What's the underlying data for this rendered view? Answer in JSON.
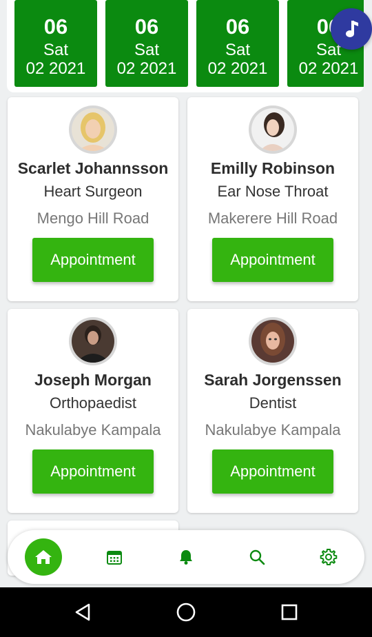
{
  "dates": [
    {
      "day": "06",
      "weekday": "Sat",
      "month_year": "02 2021"
    },
    {
      "day": "06",
      "weekday": "Sat",
      "month_year": "02 2021"
    },
    {
      "day": "06",
      "weekday": "Sat",
      "month_year": "02 2021"
    },
    {
      "day": "06",
      "weekday": "Sat",
      "month_year": "02 2021"
    }
  ],
  "doctors": [
    {
      "name": "Scarlet Johannsson",
      "specialty": "Heart Surgeon",
      "address": "Mengo Hill Road",
      "button": "Appointment"
    },
    {
      "name": "Emilly Robinson",
      "specialty": "Ear Nose Throat",
      "address": "Makerere Hill Road",
      "button": "Appointment"
    },
    {
      "name": "Joseph Morgan",
      "specialty": "Orthopaedist",
      "address": "Nakulabye Kampala",
      "button": "Appointment"
    },
    {
      "name": "Sarah Jorgenssen",
      "specialty": "Dentist",
      "address": "Nakulabye Kampala",
      "button": "Appointment"
    }
  ],
  "nav": {
    "items": [
      "home-icon",
      "calendar-icon",
      "bell-icon",
      "search-icon",
      "settings-icon"
    ],
    "active": "home"
  },
  "colors": {
    "date_card": "#0b8a10",
    "button": "#34b410",
    "fab": "#2f3aa0",
    "icon_green": "#0b8a10"
  }
}
